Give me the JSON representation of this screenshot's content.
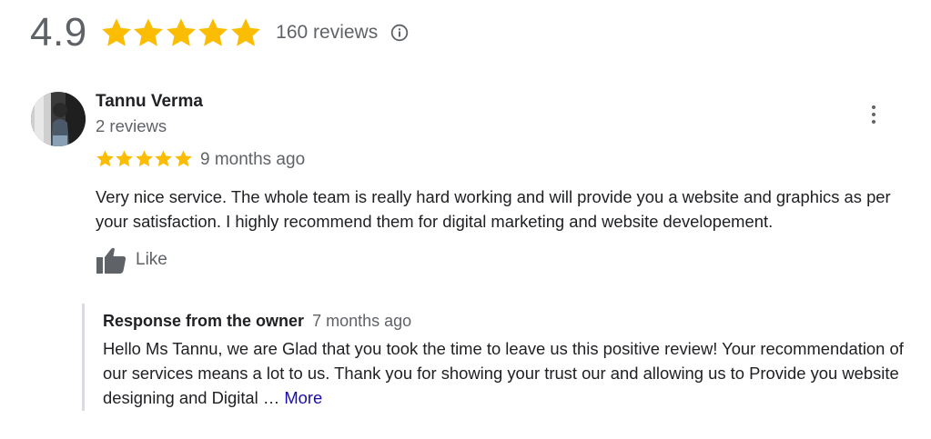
{
  "summary": {
    "rating": "4.9",
    "stars": 5,
    "reviews_count": "160 reviews",
    "info_icon": "info-icon"
  },
  "review": {
    "author": "Tannu Verma",
    "author_reviews": "2 reviews",
    "stars": 5,
    "time": "9 months ago",
    "text": "Very nice service.  The whole team is really hard working and will provide you a website and graphics as per your satisfaction. I highly recommend them for digital marketing and website developement.",
    "like_label": "Like",
    "menu_icon": "more-vert-icon"
  },
  "owner_response": {
    "title": "Response from the owner",
    "time": "7 months ago",
    "text": "Hello Ms Tannu, we are Glad that you took the time to leave us this positive review! Your recommendation of our services means a lot to us. Thank you for showing your trust our and allowing us to Provide you website designing and Digital … ",
    "more_label": "More"
  },
  "colors": {
    "star": "#fbbc04",
    "link": "#1a0dab",
    "muted_text": "#5f6368",
    "text": "#202124"
  }
}
